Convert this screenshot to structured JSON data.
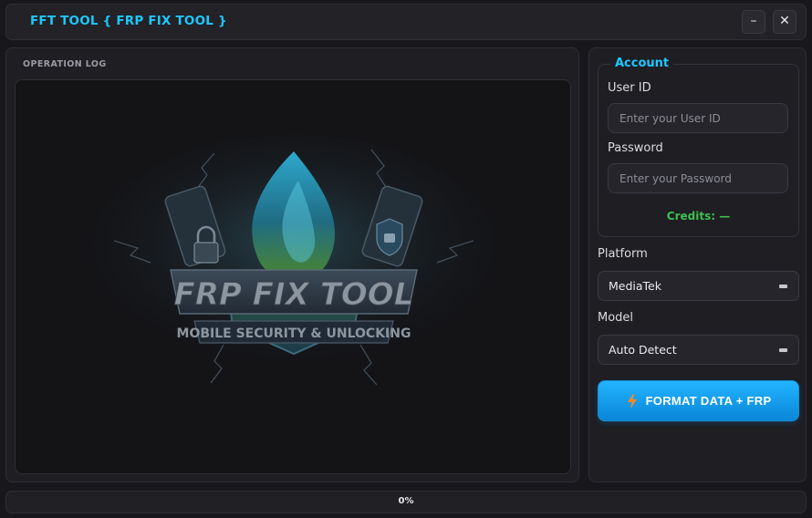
{
  "window": {
    "title": "FFT TOOL { FRP FIX TOOL }",
    "minimize_label": "–",
    "close_label": "✕"
  },
  "log": {
    "heading": "OPERATION LOG",
    "watermark": {
      "title": "FRP FIX TOOL",
      "subtitle": "MOBILE SECURITY & UNLOCKING"
    }
  },
  "account": {
    "legend": "Account",
    "user_id_label": "User ID",
    "user_id_placeholder": "Enter your User ID",
    "user_id_value": "",
    "password_label": "Password",
    "password_placeholder": "Enter your Password",
    "password_value": "",
    "credits": "Credits: —"
  },
  "platform": {
    "label": "Platform",
    "selected": "MediaTek"
  },
  "model": {
    "label": "Model",
    "selected": "Auto Detect"
  },
  "action": {
    "format_label": "FORMAT DATA + FRP",
    "icon": "lightning-bolt-icon"
  },
  "progress": {
    "value": 0,
    "text": "0%"
  },
  "colors": {
    "accent": "#1ec8ff",
    "credits": "#3fbf52",
    "button": "#0a86d8",
    "bolt": "#ff8a1e"
  }
}
